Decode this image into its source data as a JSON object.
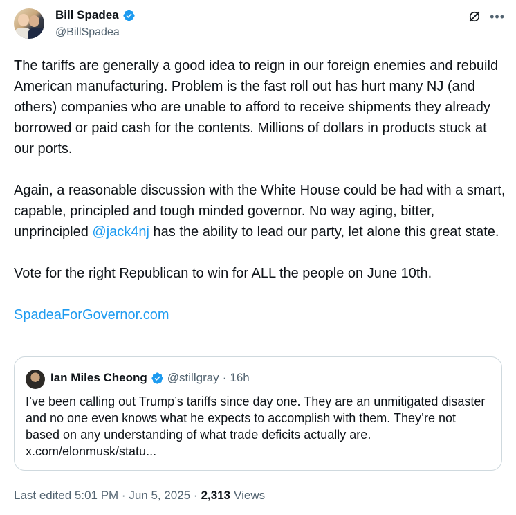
{
  "author": {
    "name": "Bill Spadea",
    "handle": "@BillSpadea",
    "verified_color": "#1d9bf0"
  },
  "icons": {
    "grok": "grok-icon",
    "more": "more-options-icon",
    "verified": "verified-badge-icon"
  },
  "tweet": {
    "paragraphs": [
      "The tariffs are generally a good idea to reign in our foreign enemies and rebuild American manufacturing. Problem is the fast roll out has hurt many NJ (and others) companies who are unable to afford to receive shipments they already borrowed or paid cash for the contents. Millions of dollars in products stuck at our ports."
    ],
    "p2_before": "Again, a reasonable discussion with the White House could be had with a smart, capable, principled and tough minded governor. No way aging, bitter, unprincipled ",
    "p2_mention": "@jack4nj",
    "p2_after": " has the ability to lead our party, let alone this great state.",
    "p3": "Vote for the right Republican to win for ALL the people on June 10th.",
    "link": "SpadeaForGovernor.com"
  },
  "quote": {
    "name": "Ian Miles Cheong",
    "handle": "@stillgray",
    "dot": "·",
    "time": "16h",
    "text": "I’ve been calling out Trump’s tariffs since day one. They are an unmitigated disaster and no one even knows what he expects to accomplish with them. They’re not based on any understanding of what trade deficits actually are. x.com/elonmusk/statu..."
  },
  "meta": {
    "edited": "Last edited 5:01 PM · Jun 5, 2025 ·",
    "views_count": "2,313",
    "views_label": "Views"
  }
}
